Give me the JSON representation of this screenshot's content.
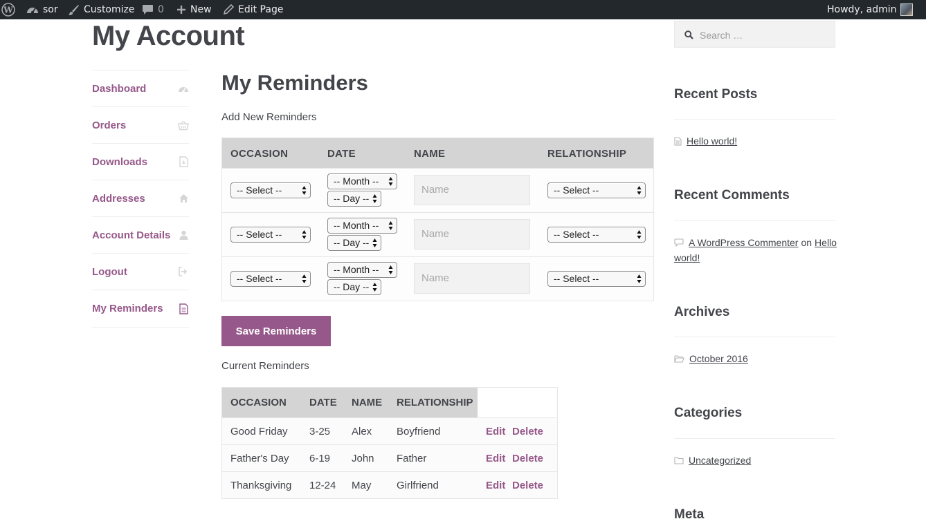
{
  "admin_bar": {
    "site_name": "sor",
    "customize": "Customize",
    "comments_count": "0",
    "new": "New",
    "edit_page": "Edit Page",
    "howdy": "Howdy, admin"
  },
  "page_title": "My Account",
  "nav": {
    "items": [
      {
        "label": "Dashboard",
        "icon": "dashboard-icon"
      },
      {
        "label": "Orders",
        "icon": "basket-icon"
      },
      {
        "label": "Downloads",
        "icon": "file-download-icon"
      },
      {
        "label": "Addresses",
        "icon": "home-icon"
      },
      {
        "label": "Account Details",
        "icon": "user-icon"
      },
      {
        "label": "Logout",
        "icon": "sign-out-icon"
      },
      {
        "label": "My Reminders",
        "icon": "document-icon"
      }
    ]
  },
  "reminders": {
    "title": "My Reminders",
    "add_label": "Add New Reminders",
    "columns": [
      "OCCASION",
      "DATE",
      "NAME",
      "RELATIONSHIP"
    ],
    "occasion_default": "-- Select --",
    "month_default": "-- Month --",
    "day_default": "-- Day --",
    "name_placeholder": "Name",
    "relationship_default": "-- Select --",
    "save_label": "Save Reminders",
    "current_label": "Current Reminders",
    "current_columns": [
      "OCCASION",
      "DATE",
      "NAME",
      "RELATIONSHIP"
    ],
    "current_rows": [
      {
        "occasion": "Good Friday",
        "date": "3-25",
        "name": "Alex",
        "relationship": "Boyfriend"
      },
      {
        "occasion": "Father's Day",
        "date": "6-19",
        "name": "John",
        "relationship": "Father"
      },
      {
        "occasion": "Thanksgiving",
        "date": "12-24",
        "name": "May",
        "relationship": "Girlfriend"
      }
    ],
    "edit_label": "Edit",
    "delete_label": "Delete"
  },
  "sidebar": {
    "search_placeholder": "Search …",
    "recent_posts_title": "Recent Posts",
    "recent_post": "Hello world!",
    "recent_comments_title": "Recent Comments",
    "comment_author": "A WordPress Commenter",
    "comment_on": "on",
    "comment_post_line1": "Hello",
    "comment_post_line2": "world!",
    "archives_title": "Archives",
    "archive_item": "October 2016",
    "categories_title": "Categories",
    "category_item": "Uncategorized",
    "meta_title": "Meta"
  },
  "colors": {
    "accent": "#96588a",
    "admin_bar": "#23282d",
    "table_header": "#d4d4d4"
  }
}
